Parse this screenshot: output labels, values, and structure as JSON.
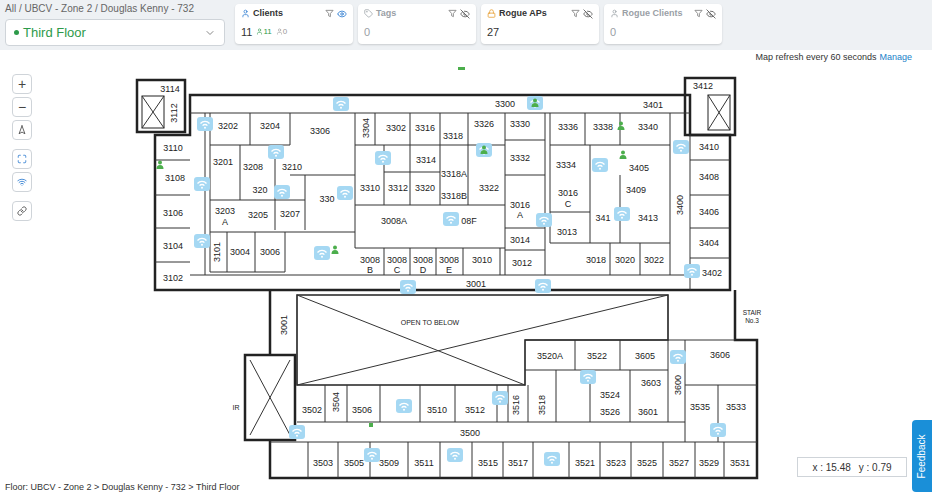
{
  "breadcrumb": "All / UBCV - Zone 2 / Douglas Kenny - 732",
  "floor_select": {
    "value": "Third Floor"
  },
  "cards": [
    {
      "title": "Clients",
      "value": "11",
      "enabled": true,
      "visible": true,
      "counts": [
        {
          "kind": "up",
          "value": "11"
        },
        {
          "kind": "down",
          "value": "0"
        }
      ]
    },
    {
      "title": "Tags",
      "value": "0",
      "enabled": false,
      "visible": false,
      "counts": []
    },
    {
      "title": "Rogue APs",
      "value": "27",
      "enabled": true,
      "visible": false,
      "counts": []
    },
    {
      "title": "Rogue Clients",
      "value": "0",
      "enabled": false,
      "visible": false,
      "counts": []
    }
  ],
  "refresh": {
    "text": "Map refresh every 60 seconds",
    "link": "Manage"
  },
  "toolbar": [
    {
      "kind": "text",
      "label": "+"
    },
    {
      "kind": "text",
      "label": "−"
    },
    {
      "kind": "north"
    },
    {
      "kind": "fit"
    },
    {
      "kind": "wifi"
    },
    {
      "kind": "link"
    }
  ],
  "map": {
    "rooms": [
      "3114",
      "3112",
      "3300",
      "3401",
      "3412",
      "3202",
      "3204",
      "3306",
      "3304",
      "3302",
      "3316",
      "3318",
      "3326",
      "3330",
      "3336",
      "3338",
      "3340",
      "3110",
      "3201",
      "3208",
      "3210",
      "3314",
      "3332",
      "3334",
      "3405",
      "3410",
      "3108",
      "320",
      "330",
      "3310",
      "3312",
      "3320",
      "3318A",
      "3318B",
      "3322",
      "3016",
      "C",
      "3409",
      "3408",
      "3106",
      "3203",
      "A",
      "3205",
      "3207",
      "3008A",
      "08F",
      "3016",
      "A",
      "341",
      "3413",
      "3406",
      "3400",
      "3014",
      "3013",
      "3104",
      "3101",
      "3004",
      "3006",
      "3404",
      "3102",
      "3008",
      "B",
      "3008",
      "C",
      "3008",
      "D",
      "3008",
      "E",
      "3010",
      "3012",
      "3018",
      "3020",
      "3022",
      "3402",
      "3001",
      "3001",
      "3520A",
      "3522",
      "3605",
      "3606",
      "3603",
      "3600",
      "3502",
      "3504",
      "3506",
      "3510",
      "3512",
      "3516",
      "3518",
      "3524",
      "3526",
      "3601",
      "3535",
      "3533",
      "3500",
      "3503",
      "3505",
      "3509",
      "3511",
      "3515",
      "3517",
      "3521",
      "3523",
      "3525",
      "3527",
      "3529",
      "3531"
    ],
    "notes": {
      "open_to_below": "OPEN TO BELOW",
      "stair": "STAIR",
      "stair_no": "No.3",
      "ir": "IR"
    }
  },
  "footer": {
    "floor_path": "Floor: UBCV - Zone 2 > Douglas Kenny - 732 > Third Floor",
    "x": "x : 15.48",
    "y": "y : 0.79"
  },
  "feedback": "Feedback"
}
